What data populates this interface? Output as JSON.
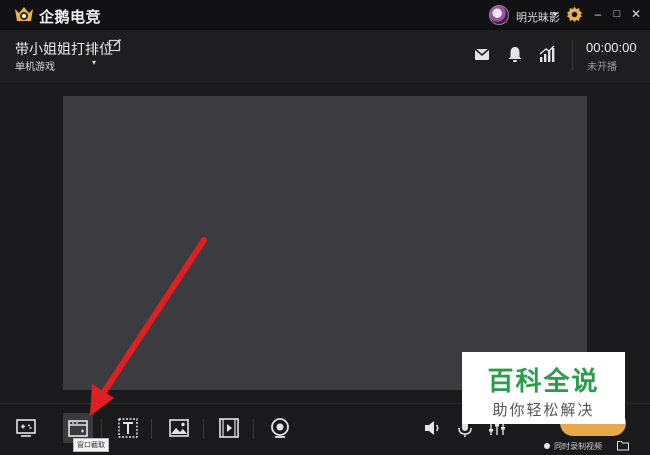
{
  "window": {
    "app_title": "企鹅电竞",
    "username": "明光昧影",
    "user_caret": "▾",
    "icons": {
      "settings": "gear-icon",
      "minimize": "minimize-icon",
      "maximize": "maximize-icon",
      "close": "close-icon"
    },
    "minimize_label": "–",
    "maximize_label": "□",
    "close_label": "✕"
  },
  "header": {
    "room_title": "带小姐姐打排位",
    "category": "单机游戏",
    "category_caret": "▾",
    "timer": "00:00:00",
    "live_status": "未开播"
  },
  "toolbar": {
    "tools": [
      {
        "name": "game-capture",
        "icon": "gamepad-monitor-icon"
      },
      {
        "name": "window-capture",
        "icon": "window-capture-icon",
        "active": true
      },
      {
        "name": "text",
        "icon": "text-icon"
      },
      {
        "name": "image",
        "icon": "image-icon"
      },
      {
        "name": "video",
        "icon": "video-icon"
      },
      {
        "name": "camera",
        "icon": "webcam-icon"
      }
    ],
    "tooltip": "窗口截取",
    "sync_label": "同时录制视频"
  },
  "watermark": {
    "title": "百科全说",
    "subtitle": "助你轻松解决"
  },
  "colors": {
    "accent_green": "#2a9d4b",
    "arrow_red": "#e02020",
    "gold": "#e9a94a",
    "canvas": "#3c3c40"
  }
}
